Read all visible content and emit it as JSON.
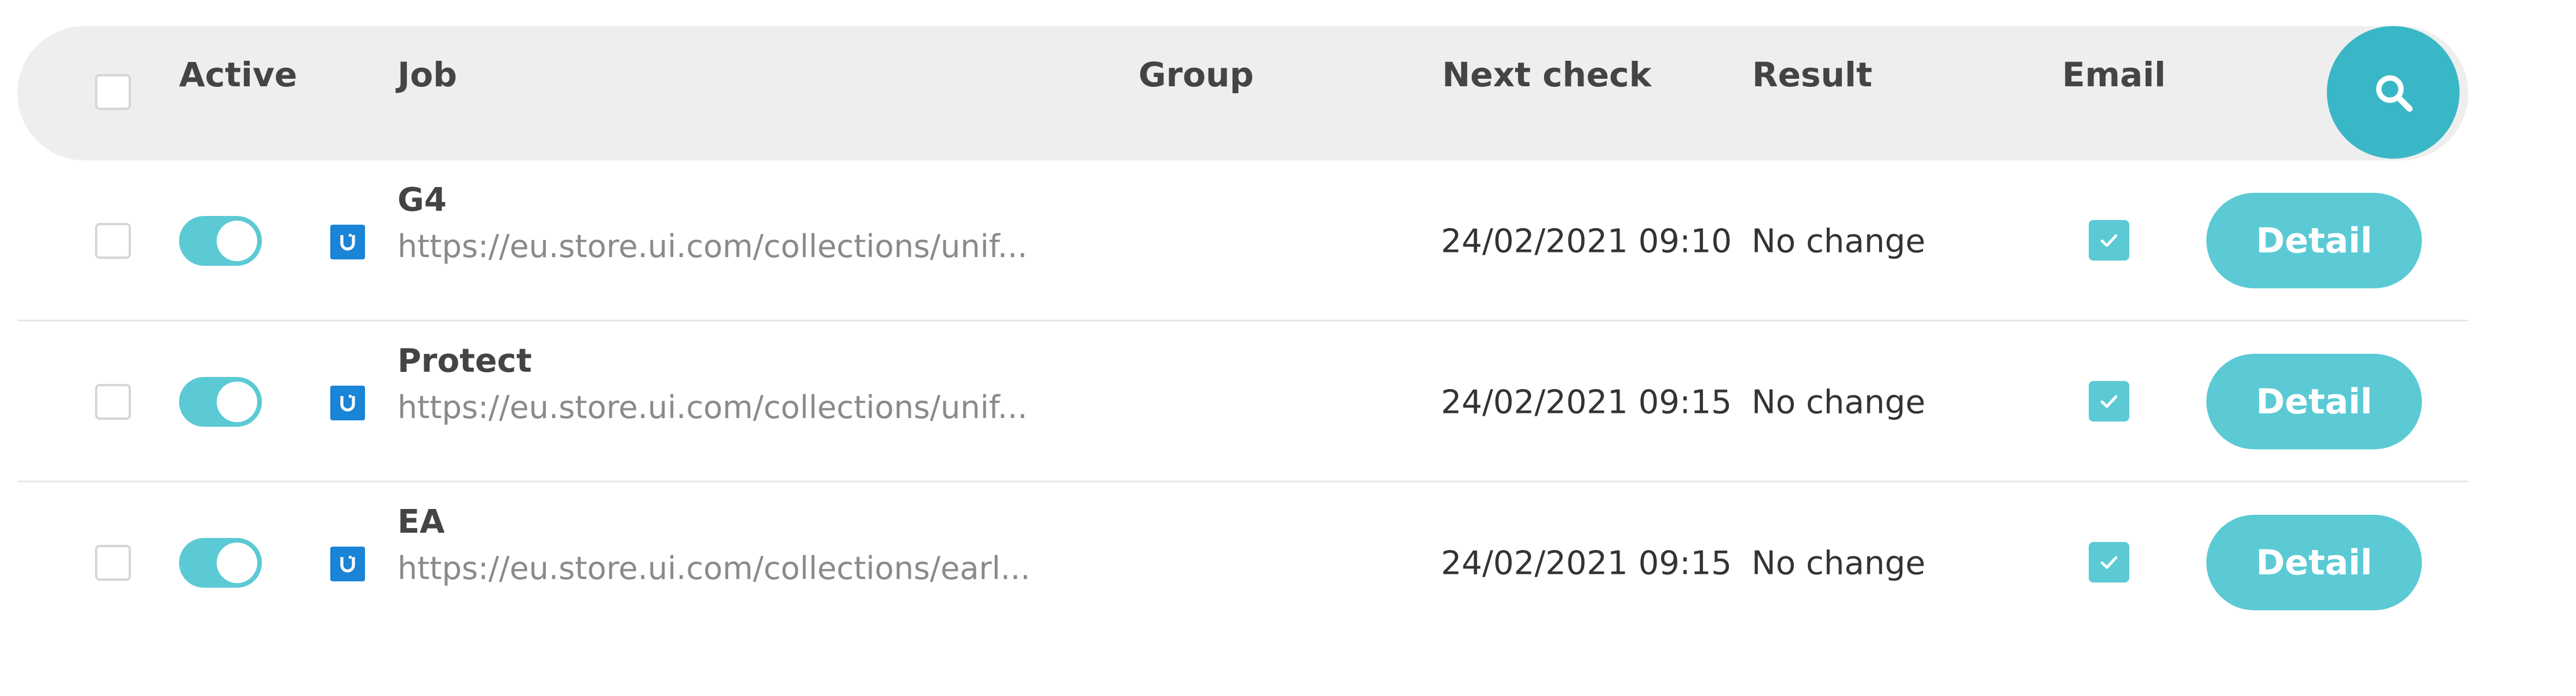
{
  "header": {
    "active_label": "Active",
    "job_label": "Job",
    "group_label": "Group",
    "next_check_label": "Next check",
    "result_label": "Result",
    "email_label": "Email",
    "search_icon": "search-icon"
  },
  "rows": [
    {
      "name": "G4",
      "url": "https://eu.store.ui.com/collections/unif...",
      "group": "",
      "next_check": "24/02/2021 09:10",
      "result": "No change",
      "active": true,
      "email": true,
      "detail_label": "Detail"
    },
    {
      "name": "Protect",
      "url": "https://eu.store.ui.com/collections/unif...",
      "group": "",
      "next_check": "24/02/2021 09:15",
      "result": "No change",
      "active": true,
      "email": true,
      "detail_label": "Detail"
    },
    {
      "name": "EA",
      "url": "https://eu.store.ui.com/collections/earl...",
      "group": "",
      "next_check": "24/02/2021 09:15",
      "result": "No change",
      "active": true,
      "email": true,
      "detail_label": "Detail"
    }
  ],
  "colors": {
    "accent": "#5bcad4",
    "search_button": "#3ab7c6",
    "header_background": "#eeeeee",
    "logo": "#1a84d6"
  }
}
